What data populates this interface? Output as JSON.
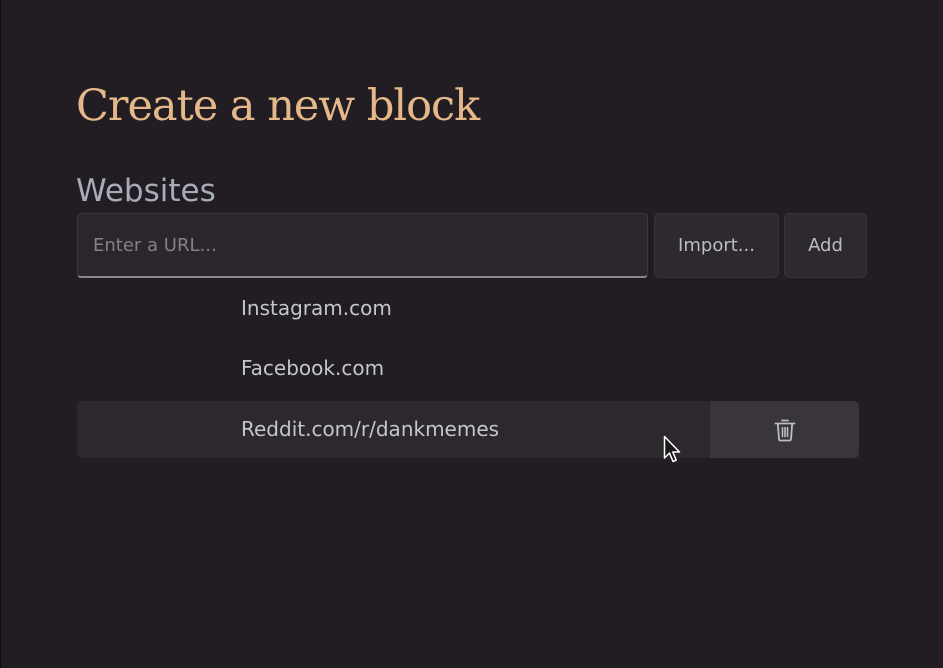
{
  "page": {
    "title": "Create a new block"
  },
  "websites": {
    "section_label": "Websites",
    "input": {
      "placeholder": "Enter a URL...",
      "value": ""
    },
    "import_label": "Import...",
    "add_label": "Add",
    "items": [
      {
        "label": "Instagram.com"
      },
      {
        "label": "Facebook.com"
      },
      {
        "label": "Reddit.com/r/dankmemes"
      }
    ]
  },
  "icons": {
    "delete": "trash-icon",
    "pointer": "mouse-pointer-icon"
  },
  "colors": {
    "background": "#211d23",
    "title": "#e5b88a",
    "section_label": "#a7adb6",
    "text": "#c3c6cc",
    "button_bg": "#2d292f",
    "hover_row_bg": "#2c282e",
    "delete_bg": "#39353b"
  }
}
